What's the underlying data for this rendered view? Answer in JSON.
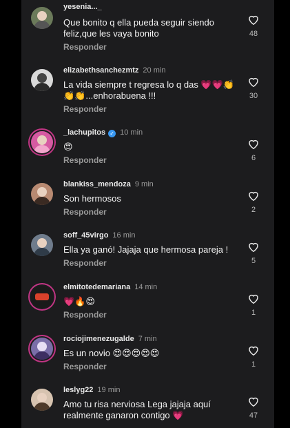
{
  "comments": [
    {
      "username": "yesenia..._",
      "time": "",
      "text": "Que bonito q ella pueda seguir siendo feliz,que les vaya bonito",
      "reply": "Responder",
      "likes": "48"
    },
    {
      "username": "elizabethsanchezmtz",
      "time": "20 min",
      "text": "La vida siempre t regresa lo q das 💗💗👏👏👏...enhorabuena !!!",
      "reply": "Responder",
      "likes": "30"
    },
    {
      "username": "_lachupitos",
      "time": "10 min",
      "text": "😍",
      "reply": "Responder",
      "likes": "6"
    },
    {
      "username": "blankiss_mendoza",
      "time": "9 min",
      "text": "Son hermosos",
      "reply": "Responder",
      "likes": "2"
    },
    {
      "username": "soff_45virgo",
      "time": "16 min",
      "text": "Ella ya ganó! Jajaja que hermosa pareja !",
      "reply": "Responder",
      "likes": "5"
    },
    {
      "username": "elmitotedemariana",
      "time": "14 min",
      "text": "💗🔥😍",
      "reply": "Responder",
      "likes": "1"
    },
    {
      "username": "rociojimenezugalde",
      "time": "7 min",
      "text": "Es un novio 😍😍😍😍😍",
      "reply": "Responder",
      "likes": "1"
    },
    {
      "username": "leslyg22",
      "time": "19 min",
      "text": "Amo tu risa nerviosa Lega jajaja aquí realmente ganaron contigo 💗",
      "reply": "",
      "likes": "47"
    }
  ],
  "icons": {
    "like": "heart-outline-icon",
    "verified": "verified-badge-icon"
  }
}
